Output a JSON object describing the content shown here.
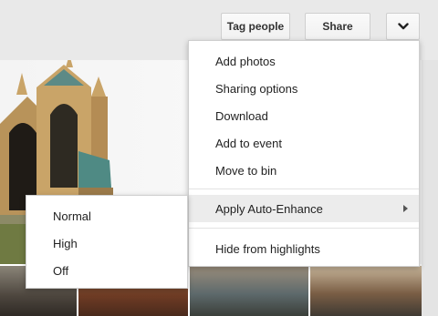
{
  "toolbar": {
    "tag_people_label": "Tag people",
    "share_label": "Share",
    "more_icon": "chevron-down-icon"
  },
  "menu": {
    "items": [
      {
        "label": "Add photos"
      },
      {
        "label": "Sharing options"
      },
      {
        "label": "Download"
      },
      {
        "label": "Add to event"
      },
      {
        "label": "Move to bin"
      },
      {
        "label": "Apply Auto-Enhance",
        "has_submenu": true,
        "highlighted": true
      },
      {
        "label": "Hide from highlights"
      }
    ]
  },
  "submenu": {
    "items": [
      {
        "label": "Normal"
      },
      {
        "label": "High"
      },
      {
        "label": "Off"
      }
    ]
  },
  "colors": {
    "toolbar_bg": "#e9e9e9",
    "menu_bg": "#ffffff",
    "highlight_bg": "#ececec",
    "menu_border": "#cfcfcf"
  }
}
